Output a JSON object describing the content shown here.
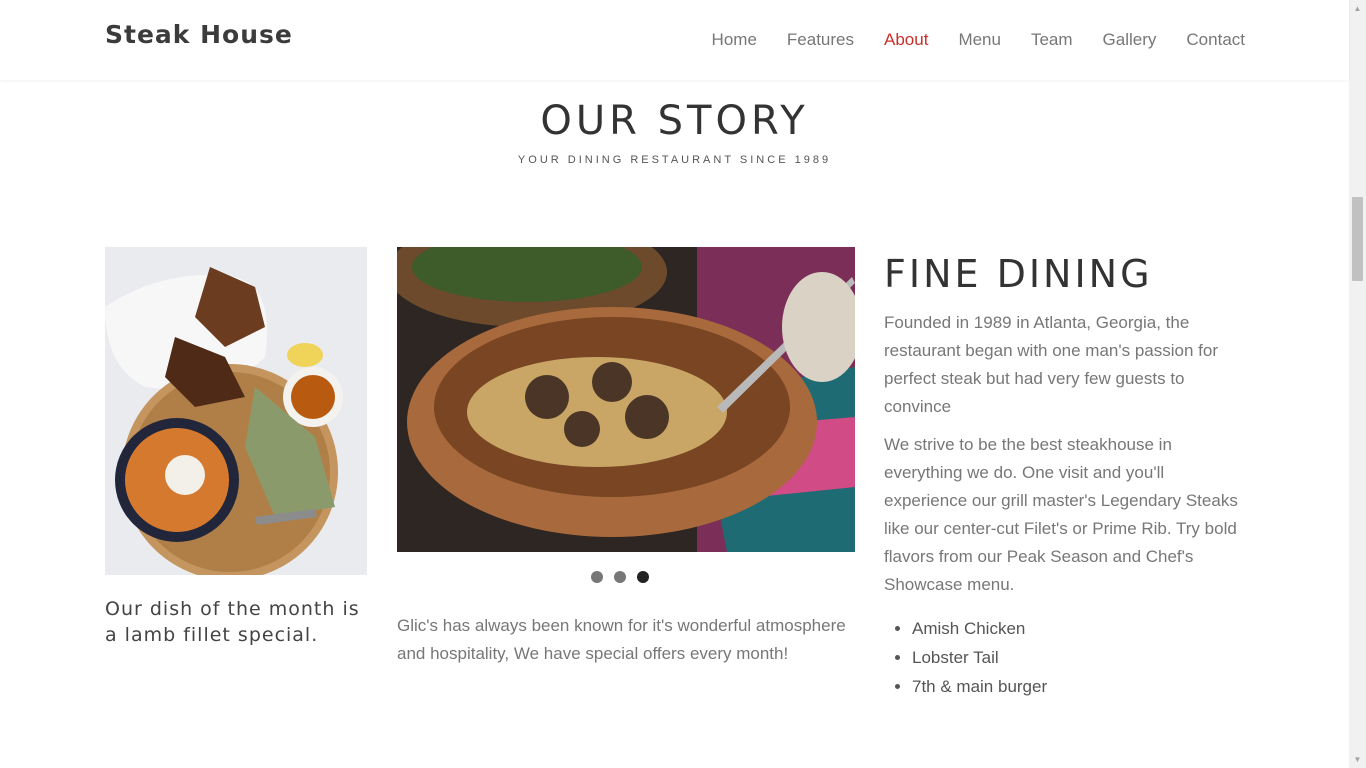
{
  "brand": "Steak House",
  "nav": {
    "items": [
      {
        "label": "Home",
        "active": false
      },
      {
        "label": "Features",
        "active": false
      },
      {
        "label": "About",
        "active": true
      },
      {
        "label": "Menu",
        "active": false
      },
      {
        "label": "Team",
        "active": false
      },
      {
        "label": "Gallery",
        "active": false
      },
      {
        "label": "Contact",
        "active": false
      }
    ],
    "active_color": "#c9302c"
  },
  "section": {
    "title": "OUR STORY",
    "subtitle": "YOUR DINING RESTAURANT SINCE 1989"
  },
  "left": {
    "caption": "Our dish of the month is a lamb fillet special."
  },
  "carousel": {
    "slide_count": 3,
    "active_slide": 3,
    "text": "Glic's has always been known for it's wonderful atmosphere and hospitality, We have special offers every month!"
  },
  "right": {
    "title": "FINE DINING",
    "para1": "Founded in 1989 in Atlanta, Georgia, the restaurant began with one man's passion for perfect steak but had very few guests to convince",
    "para2": "We strive to be the best steakhouse in everything we do. One visit and you'll experience our grill master's Legendary Steaks like our center-cut Filet's or Prime Rib. Try bold flavors from our Peak Season and Chef's Showcase menu.",
    "list": [
      "Amish Chicken",
      "Lobster Tail",
      "7th & main burger"
    ]
  }
}
